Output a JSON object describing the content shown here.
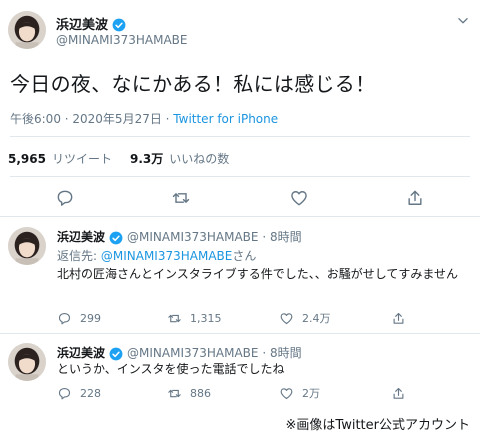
{
  "main_tweet": {
    "display_name": "浜辺美波",
    "handle": "@MINAMI373HAMABE",
    "text": "今日の夜、なにかある！私には感じる！",
    "timestamp": "午後6:00 · 2020年5月27日 · ",
    "client": "Twitter for iPhone",
    "retweets_count": "5,965",
    "retweets_label": "リツイート",
    "likes_count": "9.3万",
    "likes_label": "いいねの数"
  },
  "replies": [
    {
      "display_name": "浜辺美波",
      "handle_time": "@MINAMI373HAMABE · 8時間",
      "reply_to_prefix": "返信先: ",
      "reply_to_mention": "@MINAMI373HAMABE",
      "reply_to_suffix": "さん",
      "text": "北村の匠海さんとインスタライブする件でした、、お騒がせしてすみません",
      "reply_count": "299",
      "retweet_count": "1,315",
      "like_count": "2.4万"
    },
    {
      "display_name": "浜辺美波",
      "handle_time": "@MINAMI373HAMABE · 8時間",
      "text": "というか、インスタを使った電話でしたね",
      "reply_count": "228",
      "retweet_count": "886",
      "like_count": "2万"
    }
  ],
  "caption": "※画像はTwitter公式アカウント",
  "colors": {
    "accent": "#1b95e0",
    "secondary_text": "#657786",
    "divider": "#e1e8ed",
    "primary_text": "#14171a"
  },
  "icons": [
    "verified-icon",
    "chevron-down-icon",
    "reply-icon",
    "retweet-icon",
    "like-icon",
    "share-icon"
  ]
}
